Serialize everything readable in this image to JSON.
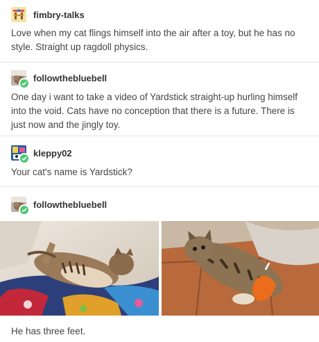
{
  "posts": [
    {
      "username": "fimbry-talks",
      "text": "Love when my cat flings himself into the air after a toy, but he has no style. Straight up ragdoll physics."
    },
    {
      "username": "followthebluebell",
      "text": "One day i want to take a video of Yardstick straight-up hurling himself into the void. Cats have no conception that there is a future. There is just now and the jingly toy."
    },
    {
      "username": "kleppy02",
      "text": "Your cat's name is Yardstick?"
    },
    {
      "username": "followthebluebell",
      "text": "He has three feet."
    }
  ],
  "colors": {
    "badge": "#4ec772",
    "divider": "#e4e4e4",
    "text": "#444444"
  },
  "icons": {
    "badge": "follow-badge-icon",
    "avatar": "avatar-icon"
  }
}
